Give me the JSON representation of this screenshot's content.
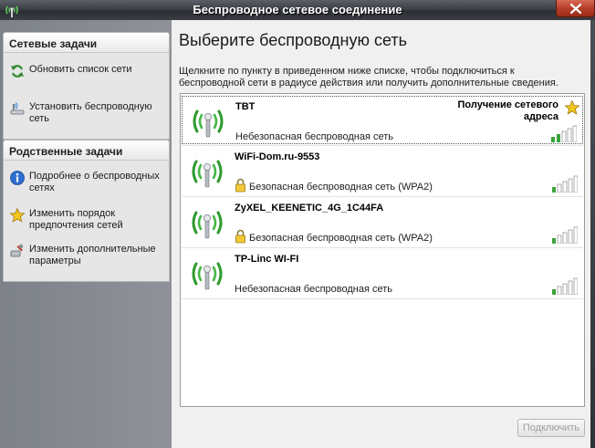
{
  "window": {
    "title": "Беспроводное сетевое соединение"
  },
  "left": {
    "network_tasks": {
      "header": "Сетевые задачи",
      "items": [
        {
          "label": "Обновить список сети",
          "icon": "refresh-icon"
        },
        {
          "label": "Установить беспроводную сеть",
          "icon": "wireless-setup-icon"
        }
      ]
    },
    "related_tasks": {
      "header": "Родственные задачи",
      "items": [
        {
          "label": "Подробнее о беспроводных сетях",
          "icon": "info-icon"
        },
        {
          "label": "Изменить порядок предпочтения сетей",
          "icon": "star-icon"
        },
        {
          "label": "Изменить дополнительные параметры",
          "icon": "settings-icon"
        }
      ]
    }
  },
  "main": {
    "title": "Выберите беспроводную сеть",
    "instructions": "Щелкните по пункту в приведенном ниже списке, чтобы подключиться к беспроводной сети в радиусе действия или получить дополнительные сведения.",
    "networks": [
      {
        "ssid": "TBT",
        "security": "Небезопасная беспроводная сеть",
        "secured": false,
        "status": "Получение сетевого адреса",
        "selected": true
      },
      {
        "ssid": "WiFi-Dom.ru-9553",
        "security": "Безопасная беспроводная сеть (WPA2)",
        "secured": true,
        "status": "",
        "selected": false
      },
      {
        "ssid": "ZyXEL_KEENETIC_4G_1C44FA",
        "security": "Безопасная беспроводная сеть (WPA2)",
        "secured": true,
        "status": "",
        "selected": false
      },
      {
        "ssid": "TP-Linc WI-FI",
        "security": "Небезопасная беспроводная сеть",
        "secured": false,
        "status": "",
        "selected": false
      }
    ],
    "connect_label": "Подключить"
  },
  "colors": {
    "signal": "#3aa53a",
    "signal_off": "#cfcfcf",
    "titlebar": "#3d4046",
    "close": "#b6402a"
  }
}
